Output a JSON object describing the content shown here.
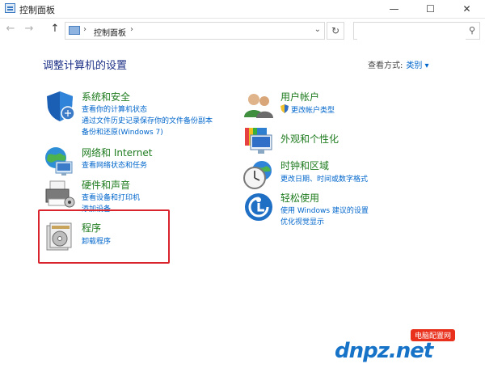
{
  "window": {
    "title": "控制面板",
    "minimize": "—",
    "maximize": "☐",
    "close": "✕"
  },
  "address_bar": {
    "back": "←",
    "forward": "→",
    "up": "↑",
    "crumb": "控制面板",
    "sep": "›",
    "dropdown": "⌄",
    "refresh": "↻",
    "search_placeholder": "",
    "search_icon": "⚲"
  },
  "heading": "调整计算机的设置",
  "view_by": {
    "label": "查看方式:",
    "value": "类别 ▾"
  },
  "categories": [
    {
      "title": "系统和安全",
      "icon": "shield-icon",
      "links": [
        "查看你的计算机状态",
        "通过文件历史记录保存你的文件备份副本",
        "备份和还原(Windows 7)"
      ]
    },
    {
      "title": "网络和 Internet",
      "icon": "network-globe-icon",
      "links": [
        "查看网络状态和任务"
      ]
    },
    {
      "title": "硬件和声音",
      "icon": "printer-icon",
      "links": [
        "查看设备和打印机",
        "添加设备"
      ]
    },
    {
      "title": "程序",
      "icon": "programs-disc-icon",
      "links": [
        "卸载程序"
      ]
    },
    {
      "title": "用户帐户",
      "icon": "users-icon",
      "links": [
        "更改帐户类型"
      ]
    },
    {
      "title": "外观和个性化",
      "icon": "monitor-palette-icon",
      "links": []
    },
    {
      "title": "时钟和区域",
      "icon": "clock-globe-icon",
      "links": [
        "更改日期、时间或数字格式"
      ]
    },
    {
      "title": "轻松使用",
      "icon": "ease-of-access-icon",
      "links": [
        "使用 Windows 建议的设置",
        "优化视觉显示"
      ]
    }
  ],
  "watermark": {
    "brand": "dnpz.net",
    "tag": "电脑配置网"
  }
}
